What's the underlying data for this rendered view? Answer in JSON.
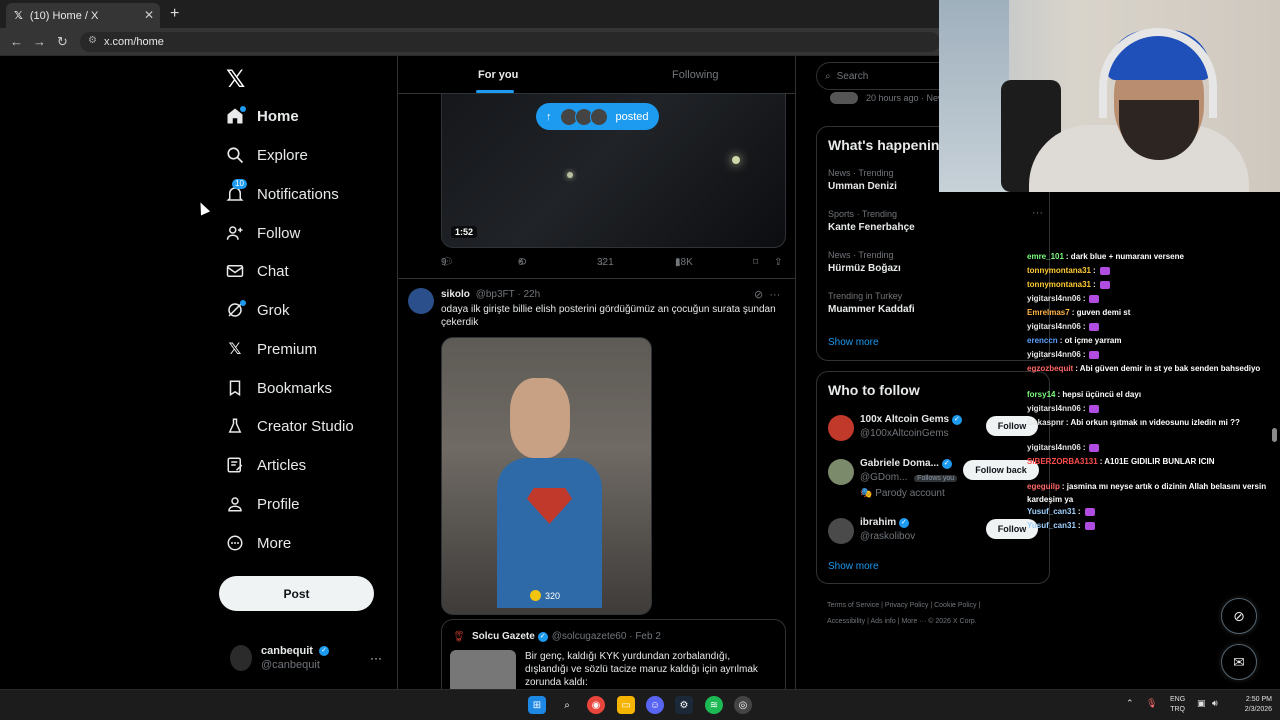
{
  "browser": {
    "tab_title": "(10) Home / X",
    "tab_close": "✕",
    "new_tab": "+",
    "url": "x.com/home"
  },
  "sidebar": {
    "logo": "𝕏",
    "items": [
      {
        "label": "Home",
        "icon": "home-icon",
        "active": true
      },
      {
        "label": "Explore",
        "icon": "search-icon"
      },
      {
        "label": "Notifications",
        "icon": "bell-icon",
        "badge": "10"
      },
      {
        "label": "Follow",
        "icon": "person-add-icon"
      },
      {
        "label": "Chat",
        "icon": "mail-icon"
      },
      {
        "label": "Grok",
        "icon": "grok-icon"
      },
      {
        "label": "Premium",
        "icon": "x-premium-icon"
      },
      {
        "label": "Bookmarks",
        "icon": "bookmark-icon"
      },
      {
        "label": "Creator Studio",
        "icon": "flask-icon"
      },
      {
        "label": "Articles",
        "icon": "articles-icon"
      },
      {
        "label": "Profile",
        "icon": "person-icon"
      },
      {
        "label": "More",
        "icon": "more-circle-icon"
      }
    ],
    "post_label": "Post",
    "account": {
      "name": "canbequit",
      "handle": "@canbequit",
      "more": "···"
    }
  },
  "timeline": {
    "tabs": {
      "for_you": "For you",
      "following": "Following"
    },
    "posted_pill": "posted",
    "video1": {
      "duration": "1:52"
    },
    "post1_actions": {
      "replies": "9",
      "reposts": "6",
      "likes": "321",
      "views": "18K"
    },
    "post2": {
      "name": "sikolo",
      "handle": "@bp3FT",
      "time": "· 22h",
      "text": "odaya ilk girişte billie elish posterini gördüğümüz an çocuğun surata şundan çekerdik",
      "video_count": "320"
    },
    "quote": {
      "name": "Solcu Gazete",
      "handle": "@solcugazete60",
      "date": "· Feb 2",
      "text": "Bir genç, kaldığı KYK yurdundan zorbalandığı, dışlandığı ve sözlü tacize maruz kaldığı için ayrılmak zorunda kaldı:"
    }
  },
  "right": {
    "search_placeholder": "Search",
    "strip_text": "20 hours ago · New",
    "happening": {
      "title": "What's happening",
      "trends": [
        {
          "meta": "News · Trending",
          "name": "Umman Denizi"
        },
        {
          "meta": "Sports · Trending",
          "name": "Kante Fenerbahçe"
        },
        {
          "meta": "News · Trending",
          "name": "Hürmüz Boğazı"
        },
        {
          "meta": "Trending in Turkey",
          "name": "Muammer Kaddafi"
        }
      ],
      "show_more": "Show more"
    },
    "who_to_follow": {
      "title": "Who to follow",
      "users": [
        {
          "name": "100x Altcoin Gems",
          "handle": "@100xAltcoinGems",
          "button": "Follow"
        },
        {
          "name": "Gabriele Doma...",
          "handle": "@GDom...",
          "follows_you": "Follows you",
          "extra": "🎭 Parody account",
          "button": "Follow back"
        },
        {
          "name": "ibrahim",
          "handle": "@raskolibov",
          "button": "Follow"
        }
      ],
      "show_more": "Show more"
    },
    "footer": {
      "l1": "Terms of Service  |  Privacy Policy  |  Cookie Policy  |",
      "l2": "Accessibility  |  Ads info  |  More ···  © 2026 X Corp."
    }
  },
  "chat": [
    {
      "user": "emre_101",
      "color": "#7cfc7c",
      "msg": ": dark blue + numaranı versene"
    },
    {
      "user": "tonnymontana31",
      "color": "#ffcc33",
      "msg": ":"
    },
    {
      "user": "tonnymontana31",
      "color": "#ffcc33",
      "msg": ":"
    },
    {
      "user": "yigitarsl4nn06",
      "color": "#e5e5e5",
      "msg": ":"
    },
    {
      "user": "Emrelmas7",
      "color": "#ffb347",
      "msg": ": guven demi st"
    },
    {
      "user": "yigitarsl4nn06",
      "color": "#e5e5e5",
      "msg": ":"
    },
    {
      "user": "erenccn",
      "color": "#5aa0ff",
      "msg": ": ot içme yarram"
    },
    {
      "user": "yigitarsl4nn06",
      "color": "#e5e5e5",
      "msg": ":"
    },
    {
      "user": "egzozbequit",
      "color": "#ff6666",
      "msg": ": Abi güven demir in st ye bak senden bahsediyo"
    },
    {
      "user": "forsy14",
      "color": "#7cfc7c",
      "msg": ": hepsi üçüncü el dayı"
    },
    {
      "user": "yigitarsl4nn06",
      "color": "#e5e5e5",
      "msg": ":"
    },
    {
      "user": "Gekaspnr",
      "color": "#e5e5e5",
      "msg": ": Abi orkun ışıtmak ın videosunu izledin mi ??"
    },
    {
      "user": "yigitarsl4nn06",
      "color": "#e5e5e5",
      "msg": ":"
    },
    {
      "user": "SIBERZORBA3131",
      "color": "#ff4d4d",
      "msg": ": A101E GIDILIR BUNLAR ICIN"
    },
    {
      "user": "egeguilp",
      "color": "#ff6666",
      "msg": ": jasmina mı neyse artık o dizinin Allah belasını versin kardeşim ya"
    },
    {
      "user": "Yusuf_can31",
      "color": "#9fd0ff",
      "msg": ":"
    },
    {
      "user": "Yusuf_can31",
      "color": "#9fd0ff",
      "msg": ":"
    }
  ],
  "taskbar": {
    "lang_top": "ENG",
    "lang_bottom": "TRQ",
    "time": "2:50 PM",
    "date": "2/3/2026"
  }
}
